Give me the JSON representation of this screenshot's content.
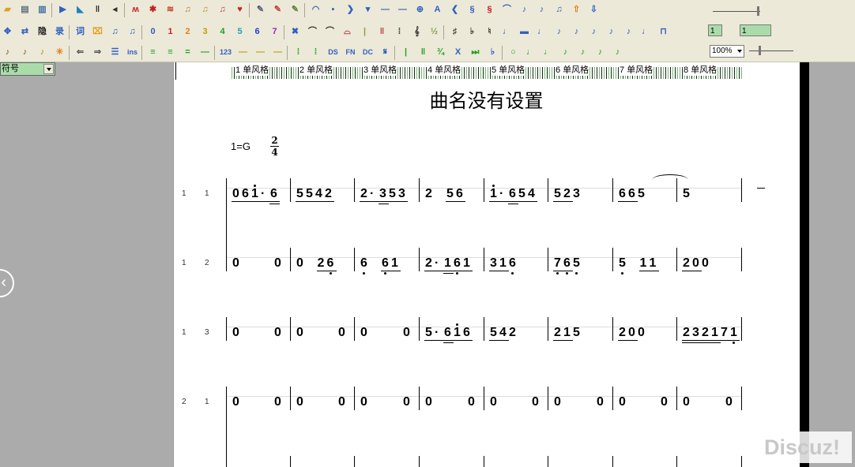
{
  "toolbar": {
    "row1": [
      {
        "n": "open-folder-icon",
        "g": "▰",
        "c": "#e0a020"
      },
      {
        "n": "save-icon",
        "g": "▤",
        "c": "#607080"
      },
      {
        "n": "grid-icon",
        "g": "▥",
        "c": "#4070a0"
      },
      {
        "n": "play-icon",
        "g": "▶",
        "c": "#3060c0"
      },
      {
        "n": "pointer-icon",
        "g": "◣",
        "c": "#2080c0"
      },
      {
        "n": "pause-icon",
        "g": "‖",
        "c": "#303030"
      },
      {
        "n": "arrow-left-icon",
        "g": "◂",
        "c": "#303030"
      },
      {
        "n": "dance-icon",
        "g": "ʍ",
        "c": "#c02020"
      },
      {
        "n": "grid-red-icon",
        "g": "✱",
        "c": "#c02020"
      },
      {
        "n": "wave-icon",
        "g": "≋",
        "c": "#c04020"
      },
      {
        "n": "notes-a-icon",
        "g": "♫",
        "c": "#c08020"
      },
      {
        "n": "notes-b-icon",
        "g": "♫",
        "c": "#c09020"
      },
      {
        "n": "notes-c-icon",
        "g": "♫",
        "c": "#c04040"
      },
      {
        "n": "heart-icon",
        "g": "♥",
        "c": "#d02020"
      },
      {
        "n": "pencil-icon",
        "g": "✎",
        "c": "#506070"
      },
      {
        "n": "pen-red-icon",
        "g": "✎",
        "c": "#c04040"
      },
      {
        "n": "pen-mark-icon",
        "g": "✎",
        "c": "#608040"
      },
      {
        "n": "circle-arc-icon",
        "g": "◠",
        "c": "#3060c0"
      },
      {
        "n": "square-icon",
        "g": "▪",
        "c": "#3060c0"
      },
      {
        "n": "chevron-right-icon",
        "g": "❯",
        "c": "#3060c0"
      },
      {
        "n": "chevron-down-icon",
        "g": "▾",
        "c": "#3060c0"
      },
      {
        "n": "line-short-icon",
        "g": "—",
        "c": "#3060c0"
      },
      {
        "n": "line-long-icon",
        "g": "—",
        "c": "#3060c0"
      },
      {
        "n": "crosshair-icon",
        "g": "⊕",
        "c": "#3060c0"
      },
      {
        "n": "text-a-icon",
        "g": "A",
        "c": "#3060c0"
      },
      {
        "n": "chevron-left-icon",
        "g": "❮",
        "c": "#3060c0"
      },
      {
        "n": "segno-icon",
        "g": "§",
        "c": "#3060c0"
      },
      {
        "n": "segno-red-icon",
        "g": "§",
        "c": "#c02020"
      },
      {
        "n": "fermata-icon",
        "g": "⌒",
        "c": "#3060c0"
      },
      {
        "n": "note-up-icon",
        "g": "♪",
        "c": "#3060c0"
      },
      {
        "n": "note-flag-icon",
        "g": "♪",
        "c": "#3060c0"
      },
      {
        "n": "beam-icon",
        "g": "♫",
        "c": "#3060c0"
      },
      {
        "n": "upload-icon",
        "g": "⇧",
        "c": "#e08020"
      },
      {
        "n": "download-icon",
        "g": "⇩",
        "c": "#3060c0"
      }
    ],
    "row2": [
      {
        "n": "move-icon",
        "g": "✥",
        "c": "#3060c0"
      },
      {
        "n": "transpose-icon",
        "g": "⇄",
        "c": "#3060c0"
      },
      {
        "n": "hide-icon",
        "t": "隐",
        "c": "#202020"
      },
      {
        "n": "record-icon",
        "t": "录",
        "c": "#3060c0"
      },
      {
        "n": "lyrics-icon",
        "t": "词",
        "c": "#3060c0"
      },
      {
        "n": "eraser-icon",
        "g": "⌧",
        "c": "#e0a020"
      },
      {
        "n": "beam-double-icon",
        "g": "♫",
        "c": "#3060c0"
      },
      {
        "n": "beam-single-icon",
        "g": "♫",
        "c": "#3060c0"
      },
      {
        "n": "digit-0-icon",
        "t": "0",
        "c": "#3060c0"
      },
      {
        "n": "digit-1-icon",
        "t": "1",
        "c": "#d02020"
      },
      {
        "n": "digit-2-icon",
        "t": "2",
        "c": "#e08020"
      },
      {
        "n": "digit-3-icon",
        "t": "3",
        "c": "#c0a000"
      },
      {
        "n": "digit-4-icon",
        "t": "4",
        "c": "#20a020"
      },
      {
        "n": "digit-5-icon",
        "t": "5",
        "c": "#20a0c0"
      },
      {
        "n": "digit-6-icon",
        "t": "6",
        "c": "#2040d0"
      },
      {
        "n": "digit-7-icon",
        "t": "7",
        "c": "#a020c0"
      },
      {
        "n": "delete-icon",
        "g": "✖",
        "c": "#3060c0"
      },
      {
        "n": "tie-icon",
        "g": "⌒",
        "c": "#303030"
      },
      {
        "n": "slur-icon",
        "g": "⌒",
        "c": "#303030"
      },
      {
        "n": "arch-icon",
        "g": "⌓",
        "c": "#c04040"
      },
      {
        "n": "barline-icon",
        "g": "|",
        "c": "#80a040"
      },
      {
        "n": "double-bar-icon",
        "g": "‖",
        "c": "#c04040"
      },
      {
        "n": "repeat-icon",
        "g": "⁞",
        "c": "#303030"
      },
      {
        "n": "treble-clef-icon",
        "g": "𝄞",
        "c": "#303030"
      },
      {
        "n": "fraction-icon",
        "g": "½",
        "c": "#80a040"
      },
      {
        "n": "sharp-icon",
        "g": "♯",
        "c": "#303030"
      },
      {
        "n": "flat-icon",
        "g": "♭",
        "c": "#303030"
      },
      {
        "n": "natural-icon",
        "g": "♮",
        "c": "#303030"
      },
      {
        "n": "note-a-icon",
        "g": "♩",
        "c": "#3060c0"
      },
      {
        "n": "rest-icon",
        "g": "▬",
        "c": "#3060c0"
      },
      {
        "n": "note-b-icon",
        "g": "♩",
        "c": "#3060c0"
      },
      {
        "n": "note-c-icon",
        "g": "♪",
        "c": "#3060c0"
      },
      {
        "n": "note-d-icon",
        "g": "♪",
        "c": "#3060c0"
      },
      {
        "n": "note-e-icon",
        "g": "♪",
        "c": "#3060c0"
      },
      {
        "n": "note-f-icon",
        "g": "♪",
        "c": "#3060c0"
      },
      {
        "n": "note-g-icon",
        "g": "♪",
        "c": "#3060c0"
      },
      {
        "n": "note-h-icon",
        "g": "♩",
        "c": "#3060c0"
      },
      {
        "n": "bracket-icon",
        "g": "⊓",
        "c": "#3060c0"
      }
    ],
    "row3": [
      {
        "n": "guitar-icon",
        "g": "♪",
        "c": "#805020"
      },
      {
        "n": "violin-icon",
        "g": "♪",
        "c": "#805020"
      },
      {
        "n": "sax-icon",
        "g": "♪",
        "c": "#c08020"
      },
      {
        "n": "sparkle-icon",
        "g": "✳",
        "c": "#e08020"
      },
      {
        "n": "undo-arrow-icon",
        "g": "⇐",
        "c": "#505050"
      },
      {
        "n": "redo-arrow-icon",
        "g": "⇒",
        "c": "#505050"
      },
      {
        "n": "lines-icon",
        "g": "☰",
        "c": "#3060c0"
      },
      {
        "n": "insert-icon",
        "t": "ins",
        "c": "#3060c0"
      },
      {
        "n": "align-a-icon",
        "g": "≡",
        "c": "#20a020"
      },
      {
        "n": "align-b-icon",
        "g": "≡",
        "c": "#20a020"
      },
      {
        "n": "align-c-icon",
        "g": "=",
        "c": "#20a020"
      },
      {
        "n": "line-dash-icon",
        "g": "—",
        "c": "#20a020"
      },
      {
        "n": "number-123-icon",
        "t": "123",
        "c": "#3060c0"
      },
      {
        "n": "dash-a-icon",
        "g": "—",
        "c": "#c0a000"
      },
      {
        "n": "dash-b-icon",
        "g": "—",
        "c": "#c0a000"
      },
      {
        "n": "dash-c-icon",
        "g": "—",
        "c": "#c0a000"
      },
      {
        "n": "repeat-open-icon",
        "g": "⁞",
        "c": "#20a020"
      },
      {
        "n": "repeat-close-icon",
        "g": "⁞",
        "c": "#20a020"
      },
      {
        "n": "ds-icon",
        "t": "DS",
        "c": "#3060c0"
      },
      {
        "n": "fine-icon",
        "t": "FN",
        "c": "#3060c0"
      },
      {
        "n": "dc-icon",
        "t": "DC",
        "c": "#3060c0"
      },
      {
        "n": "coda-icon",
        "g": "𝄋",
        "c": "#3060c0"
      },
      {
        "n": "bar-single-icon",
        "g": "|",
        "c": "#20a020"
      },
      {
        "n": "bar-double-icon",
        "g": "‖",
        "c": "#20a020"
      },
      {
        "n": "fraction-green-icon",
        "g": "¾",
        "c": "#20a020"
      },
      {
        "n": "close-x-icon",
        "t": "X",
        "c": "#3060c0"
      },
      {
        "n": "skip-icon",
        "g": "⏭",
        "c": "#20a020"
      },
      {
        "n": "flat-mark-icon",
        "g": "♭",
        "c": "#3060c0"
      },
      {
        "n": "circle-o-icon",
        "g": "○",
        "c": "#20a020"
      },
      {
        "n": "note-g1-icon",
        "g": "♩",
        "c": "#20a020"
      },
      {
        "n": "note-g2-icon",
        "g": "♩",
        "c": "#20a020"
      },
      {
        "n": "note-g3-icon",
        "g": "♪",
        "c": "#20a020"
      },
      {
        "n": "note-g4-icon",
        "g": "♪",
        "c": "#20a020"
      },
      {
        "n": "note-g5-icon",
        "g": "♪",
        "c": "#20a020"
      },
      {
        "n": "note-g6-icon",
        "g": "♪",
        "c": "#20a020"
      }
    ]
  },
  "controls": {
    "num_box_1": "1",
    "num_box_2": "1",
    "zoom_value": "100%",
    "left_select_value": "符号"
  },
  "score": {
    "title": "曲名没有设置",
    "key_signature": "1=G",
    "time_signature": {
      "numerator": "2",
      "denominator": "4"
    },
    "style_header": [
      "1 单风格",
      "2 单风格",
      "3 单风格",
      "4 单风格",
      "5 单风格",
      "6 单风格",
      "7 单风格",
      "8 单风格"
    ],
    "rows": [
      {
        "group": "1",
        "part": "1",
        "measures": [
          [
            {
              "d": "0",
              "u": 1
            },
            {
              "d": "6",
              "u": 1
            },
            {
              "d": "1",
              "u": 1,
              "hi": true
            },
            {
              "d": "·",
              "u": 1
            },
            {
              "d": "6",
              "u": 2
            }
          ],
          [
            {
              "d": "5",
              "u": 1
            },
            {
              "d": "5",
              "u": 1
            },
            {
              "d": "4",
              "u": 1
            },
            {
              "d": "2",
              "u": 1
            }
          ],
          [
            {
              "d": "2",
              "u": 1
            },
            {
              "d": "·",
              "u": 1
            },
            {
              "d": "3",
              "u": 2
            },
            {
              "d": "5",
              "u": 1
            },
            {
              "d": "3",
              "u": 1
            }
          ],
          [
            {
              "d": "2"
            },
            {
              "d": "5",
              "u": 1
            },
            {
              "d": "6",
              "u": 1
            }
          ],
          [
            {
              "d": "1",
              "u": 1,
              "hi": true
            },
            {
              "d": "·",
              "u": 1
            },
            {
              "d": "6",
              "u": 2
            },
            {
              "d": "5",
              "u": 1
            },
            {
              "d": "4",
              "u": 1
            }
          ],
          [
            {
              "d": "5",
              "u": 1
            },
            {
              "d": "2",
              "u": 1
            },
            {
              "d": "3"
            }
          ],
          [
            {
              "d": "6",
              "u": 1
            },
            {
              "d": "6",
              "u": 1
            },
            {
              "d": "5"
            }
          ],
          [
            {
              "d": "5"
            },
            {
              "dash": true
            }
          ]
        ]
      },
      {
        "group": "1",
        "part": "2",
        "measures": [
          [
            {
              "d": "0"
            },
            {
              "d": "0"
            }
          ],
          [
            {
              "d": "0"
            },
            {
              "d": "2",
              "u": 1
            },
            {
              "d": "6",
              "u": 1,
              "lo": true
            }
          ],
          [
            {
              "d": "6",
              "lo": true
            },
            {
              "d": "6",
              "u": 1,
              "lo": true
            },
            {
              "d": "1",
              "u": 1
            }
          ],
          [
            {
              "d": "2",
              "u": 1
            },
            {
              "d": "·",
              "u": 1
            },
            {
              "d": "1",
              "u": 2
            },
            {
              "d": "6",
              "u": 1,
              "lo": true
            },
            {
              "d": "1",
              "u": 1
            }
          ],
          [
            {
              "d": "3",
              "u": 1
            },
            {
              "d": "1",
              "u": 1
            },
            {
              "d": "6",
              "lo": true
            }
          ],
          [
            {
              "d": "7",
              "u": 1,
              "lo": true
            },
            {
              "d": "6",
              "u": 1,
              "lo": true
            },
            {
              "d": "5",
              "lo": true
            }
          ],
          [
            {
              "d": "5",
              "lo": true
            },
            {
              "d": "1",
              "u": 1
            },
            {
              "d": "1",
              "u": 1
            }
          ],
          [
            {
              "d": "2",
              "u": 1
            },
            {
              "d": "0",
              "u": 1
            },
            {
              "d": "0"
            }
          ]
        ]
      },
      {
        "group": "1",
        "part": "3",
        "measures": [
          [
            {
              "d": "0"
            },
            {
              "d": "0"
            }
          ],
          [
            {
              "d": "0"
            },
            {
              "d": "0"
            }
          ],
          [
            {
              "d": "0"
            },
            {
              "d": "0"
            }
          ],
          [
            {
              "d": "5",
              "u": 1
            },
            {
              "d": "·",
              "u": 1
            },
            {
              "d": "6",
              "u": 2
            },
            {
              "d": "1",
              "u": 1,
              "hi": true
            },
            {
              "d": "6",
              "u": 1
            }
          ],
          [
            {
              "d": "5",
              "u": 1
            },
            {
              "d": "4",
              "u": 1
            },
            {
              "d": "2"
            }
          ],
          [
            {
              "d": "2",
              "u": 1
            },
            {
              "d": "1",
              "u": 1
            },
            {
              "d": "5"
            }
          ],
          [
            {
              "d": "2",
              "u": 1
            },
            {
              "d": "0",
              "u": 1
            },
            {
              "d": "0"
            }
          ],
          [
            {
              "d": "2",
              "u": 2
            },
            {
              "d": "3",
              "u": 2
            },
            {
              "d": "2",
              "u": 2
            },
            {
              "d": "1",
              "u": 2
            },
            {
              "d": "7",
              "u": 1
            },
            {
              "d": "1",
              "u": 1,
              "lo": true
            }
          ]
        ]
      },
      {
        "group": "2",
        "part": "1",
        "measures": [
          [
            {
              "d": "0"
            },
            {
              "d": "0"
            }
          ],
          [
            {
              "d": "0"
            },
            {
              "d": "0"
            }
          ],
          [
            {
              "d": "0"
            },
            {
              "d": "0"
            }
          ],
          [
            {
              "d": "0"
            },
            {
              "d": "0"
            }
          ],
          [
            {
              "d": "0"
            },
            {
              "d": "0"
            }
          ],
          [
            {
              "d": "0"
            },
            {
              "d": "0"
            }
          ],
          [
            {
              "d": "0"
            },
            {
              "d": "0"
            }
          ],
          [
            {
              "d": "0"
            },
            {
              "d": "0"
            }
          ]
        ]
      }
    ]
  },
  "watermark": "Discuz!"
}
